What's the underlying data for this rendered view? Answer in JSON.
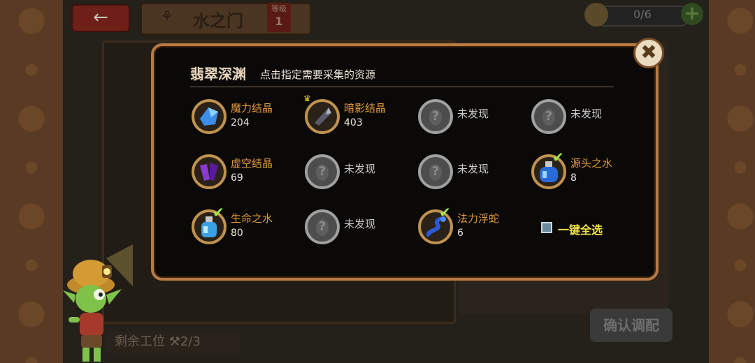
{
  "header": {
    "back_label": "←",
    "title": "水之门",
    "level_label": "等级",
    "level_value": "1",
    "worker_count": "0/6",
    "add_label": "+"
  },
  "footer": {
    "remaining_slots": "剩余工位  ⚒2/3",
    "confirm_label": "确认调配"
  },
  "modal": {
    "title": "翡翠深渊",
    "subtitle": "点击指定需要采集的资源",
    "close_label": "✖",
    "select_all_label": "一键全选",
    "resources": [
      {
        "name": "魔力结晶",
        "count": "204",
        "icon": "blue-crystal-icon",
        "known": true,
        "selected": false,
        "crown": false
      },
      {
        "name": "暗影结晶",
        "count": "403",
        "icon": "shadow-crystal-icon",
        "known": true,
        "selected": false,
        "crown": true
      },
      {
        "name": "未发现",
        "count": "",
        "icon": "unknown-icon",
        "known": false
      },
      {
        "name": "未发现",
        "count": "",
        "icon": "unknown-icon",
        "known": false
      },
      {
        "name": "虚空结晶",
        "count": "69",
        "icon": "void-crystal-icon",
        "known": true,
        "selected": false
      },
      {
        "name": "未发现",
        "count": "",
        "icon": "unknown-icon",
        "known": false
      },
      {
        "name": "未发现",
        "count": "",
        "icon": "unknown-icon",
        "known": false
      },
      {
        "name": "源头之水",
        "count": "8",
        "icon": "source-water-icon",
        "known": true,
        "selected": true
      },
      {
        "name": "生命之水",
        "count": "80",
        "icon": "life-water-icon",
        "known": true,
        "selected": true
      },
      {
        "name": "未发现",
        "count": "",
        "icon": "unknown-icon",
        "known": false
      },
      {
        "name": "法力浮蛇",
        "count": "6",
        "icon": "mana-serpent-icon",
        "known": true,
        "selected": true
      }
    ]
  },
  "colors": {
    "frame": "#b97a43",
    "resource_name": "#e29a3a",
    "select_all": "#f0e24a",
    "check": "#9fe84a"
  }
}
